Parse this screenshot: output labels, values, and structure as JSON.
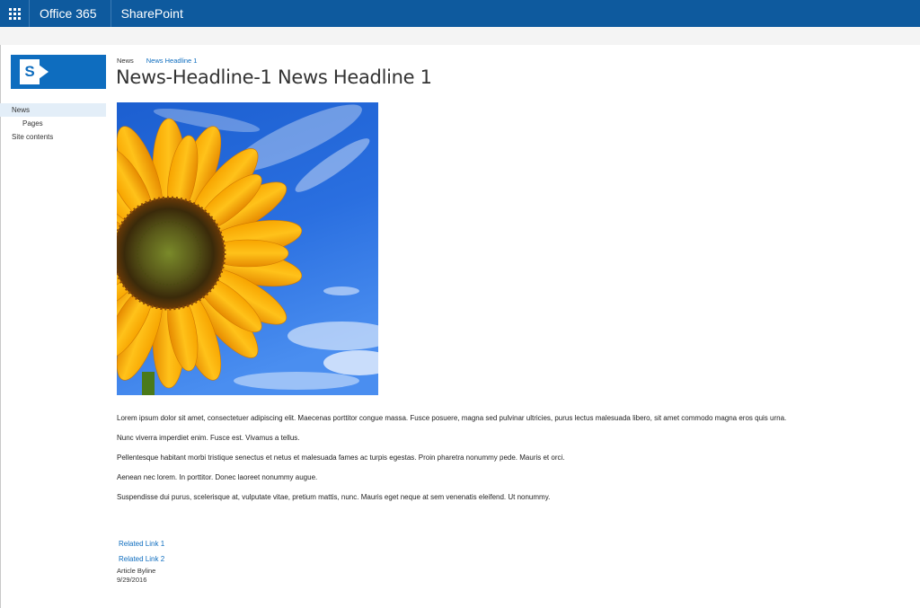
{
  "suitebar": {
    "brand": "Office 365",
    "app": "SharePoint"
  },
  "site": {
    "logo_letter": "S"
  },
  "nav": {
    "items": [
      {
        "label": "News",
        "selected": true
      },
      {
        "label": "Pages"
      },
      {
        "label": "Site contents"
      }
    ]
  },
  "breadcrumb": [
    "News",
    "News Headline 1"
  ],
  "page": {
    "title": "News-Headline-1 News Headline 1"
  },
  "article": {
    "paragraphs": [
      "Lorem ipsum dolor sit amet, consectetuer adipiscing elit. Maecenas porttitor congue massa. Fusce posuere, magna sed pulvinar ultricies, purus lectus malesuada libero, sit amet commodo magna eros quis urna.",
      "Nunc viverra imperdiet enim. Fusce est. Vivamus a tellus.",
      "Pellentesque habitant morbi tristique senectus et netus et malesuada fames ac turpis egestas. Proin pharetra nonummy pede. Mauris et orci.",
      "Aenean nec lorem. In porttitor. Donec laoreet nonummy augue.",
      "Suspendisse dui purus, scelerisque at, vulputate vitae, pretium mattis, nunc. Mauris eget neque at sem venenatis eleifend. Ut nonummy."
    ],
    "related_links": [
      "Related Link 1",
      "Related Link 2"
    ],
    "byline_label": "Article Byline",
    "date": "9/29/2016"
  },
  "colors": {
    "suitebar": "#0e5a9e",
    "accent": "#0e6dbf",
    "nav_selected": "#e3eef8"
  },
  "icons": {
    "app_launcher": "waffle-icon",
    "logo": "sharepoint-logo-icon"
  }
}
